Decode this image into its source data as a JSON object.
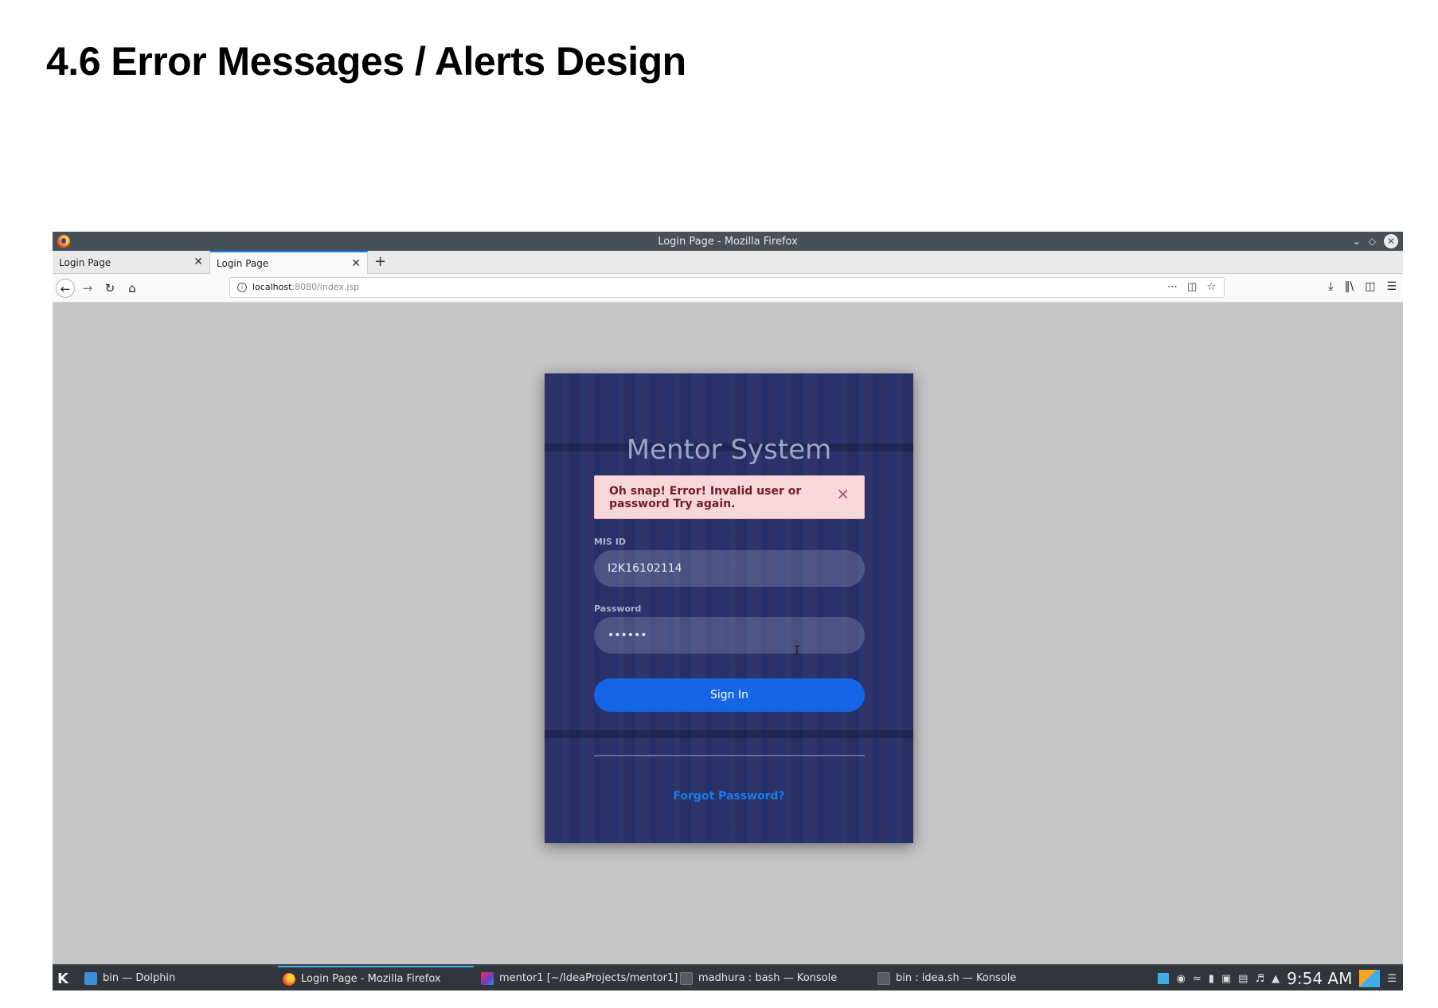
{
  "document": {
    "heading": "4.6 Error Messages / Alerts Design"
  },
  "window": {
    "title": "Login Page - Mozilla Firefox"
  },
  "tabs": [
    {
      "label": "Login Page",
      "active": false
    },
    {
      "label": "Login Page",
      "active": true
    }
  ],
  "urlbar": {
    "host": "localhost",
    "path": ":8080/index.jsp"
  },
  "login": {
    "title": "Mentor System",
    "alert": {
      "message": "Oh snap! Error! Invalid user or password Try again.",
      "close": "×"
    },
    "mis_label": "MIS ID",
    "mis_value": "I2K16102114",
    "password_label": "Password",
    "password_value": "••••••",
    "signin_label": "Sign In",
    "forgot_label": "Forgot Password?"
  },
  "taskbar": {
    "tasks": [
      {
        "label": "bin — Dolphin",
        "icon": "folder-icon"
      },
      {
        "label": "Login Page - Mozilla Firefox",
        "icon": "firefox-icon",
        "active": true
      },
      {
        "label": "mentor1 [~/IdeaProjects/mentor1] ...",
        "icon": "intellij-icon"
      },
      {
        "label": "madhura : bash — Konsole",
        "icon": "konsole-icon"
      },
      {
        "label": "bin : idea.sh — Konsole",
        "icon": "konsole-icon"
      }
    ],
    "clock": "9:54 AM"
  },
  "colors": {
    "accent": "#1565e6",
    "alert_bg": "#f8d7da",
    "alert_text": "#721c24",
    "link": "#1a7ce8",
    "titlebar": "#475057",
    "taskbar": "#30363b"
  }
}
